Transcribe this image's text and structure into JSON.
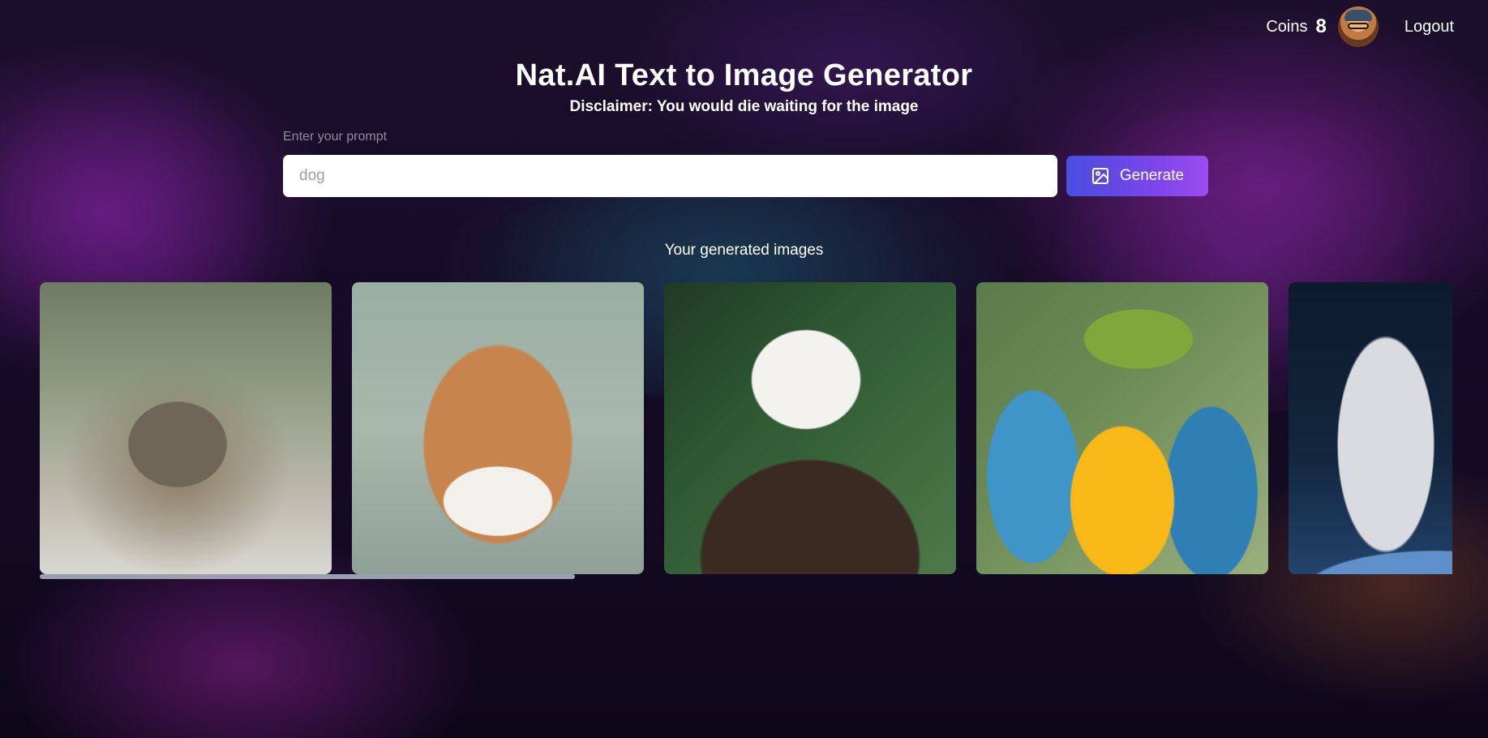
{
  "header": {
    "coins_label": "Coins",
    "coins_value": "8",
    "logout_label": "Logout"
  },
  "main": {
    "title": "Nat.AI Text to Image Generator",
    "disclaimer": "Disclaimer: You would die waiting for the image",
    "prompt_label": "Enter your prompt",
    "prompt_placeholder": "dog",
    "generate_label": "Generate",
    "gallery_title": "Your generated images"
  },
  "gallery": {
    "images": [
      {
        "subject": "cat"
      },
      {
        "subject": "dog"
      },
      {
        "subject": "eagle"
      },
      {
        "subject": "parrot"
      },
      {
        "subject": "astronaut"
      }
    ],
    "scroll_position_fraction": 0.0
  },
  "colors": {
    "accent_start": "#4a4ee0",
    "accent_end": "#9b4cf0",
    "text": "#ffffff"
  },
  "icons": {
    "generate": "image-icon"
  }
}
